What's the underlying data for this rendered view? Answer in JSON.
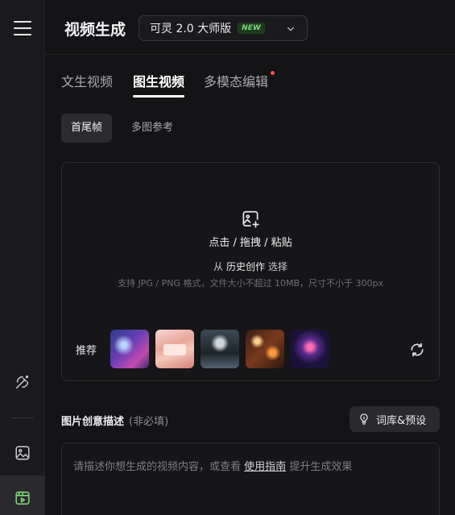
{
  "header": {
    "title": "视频生成",
    "model": {
      "name": "可灵 2.0 大师版",
      "badge": "NEW"
    }
  },
  "tabs": [
    {
      "label": "文生视频",
      "active": false
    },
    {
      "label": "图生视频",
      "active": true
    },
    {
      "label": "多模态编辑",
      "active": false,
      "dot": true
    }
  ],
  "subtabs": [
    {
      "label": "首尾帧",
      "active": true
    },
    {
      "label": "多图参考",
      "active": false
    }
  ],
  "upload": {
    "action_text": "点击 / 拖拽 / 粘贴",
    "from_prefix": "从",
    "history_link": "历史创作",
    "from_suffix": "选择",
    "hint": "支持 JPG / PNG 格式，文件大小不超过 10MB，尺寸不小于 300px",
    "recommend_label": "推荐"
  },
  "description": {
    "title": "图片创意描述",
    "optional": "(非必填)",
    "library_button": "词库&预设",
    "placeholder_prefix": "请描述你想生成的视频内容，或查看",
    "guide_link": "使用指南",
    "placeholder_suffix": "提升生成效果"
  },
  "colors": {
    "accent_green": "#7dd87a",
    "new_dot": "#ff4d4d",
    "background": "#141416"
  },
  "icons": [
    "menu-icon",
    "magic-pen-icon",
    "image-icon",
    "video-icon",
    "chevron-down-icon",
    "image-plus-icon",
    "refresh-icon",
    "lightbulb-icon"
  ]
}
